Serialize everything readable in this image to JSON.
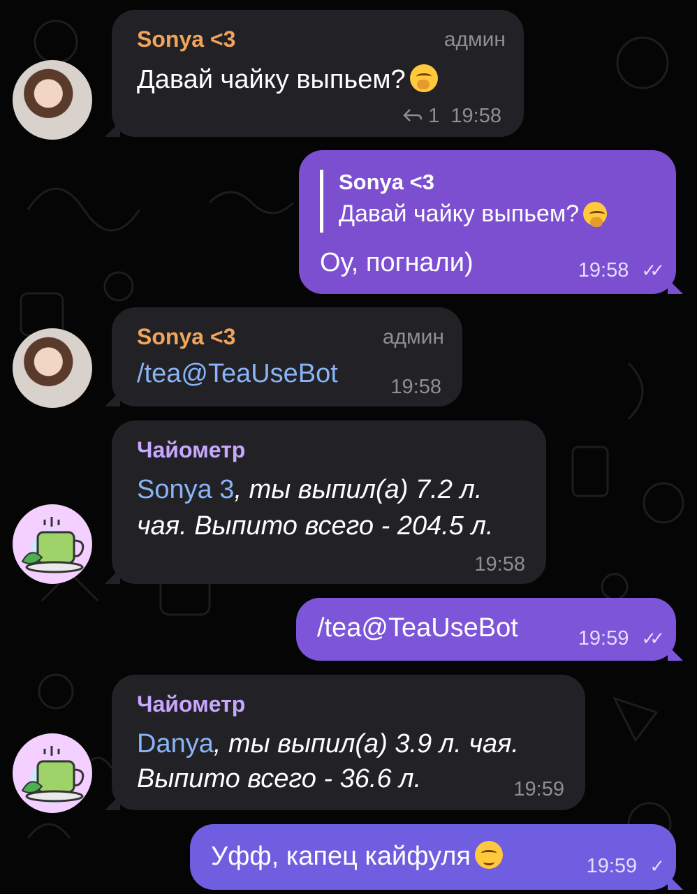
{
  "colors": {
    "background": "#050505",
    "incoming_bubble": "#222226",
    "outgoing_bubble": "#7b4fd0",
    "sender_name_sonya": "#f2a45a",
    "sender_name_bot": "#c7a7ff",
    "link": "#8ab4f8"
  },
  "messages": [
    {
      "sender": "Sonya <3",
      "role": "админ",
      "text": "Давай чайку выпьем?",
      "emoji": "yawning-face",
      "reply_count": "1",
      "time": "19:58"
    },
    {
      "reply_to": {
        "sender": "Sonya <3",
        "text": "Давай чайку выпьем?"
      },
      "text": "Оу, погнали)",
      "time": "19:58",
      "status": "read"
    },
    {
      "sender": "Sonya <3",
      "role": "админ",
      "text": "/tea@TeaUseBot",
      "time": "19:58"
    },
    {
      "sender": "Чайометр",
      "mention": "Sonya 3",
      "text_line1": ", ты выпил(а) 7.2 л.",
      "text_line2": "чая. Выпито всего - 204.5 л.",
      "time": "19:58"
    },
    {
      "text": "/tea@TeaUseBot",
      "time": "19:59",
      "status": "read"
    },
    {
      "sender": "Чайометр",
      "mention": "Danya",
      "text_line1": ", ты выпил(а) 3.9 л. чая.",
      "text_line2": "Выпито всего - 36.6 л.",
      "time": "19:59"
    },
    {
      "text": "Уфф, капец кайфуля",
      "emoji": "drooling-face",
      "time": "19:59",
      "status": "sent"
    }
  ]
}
